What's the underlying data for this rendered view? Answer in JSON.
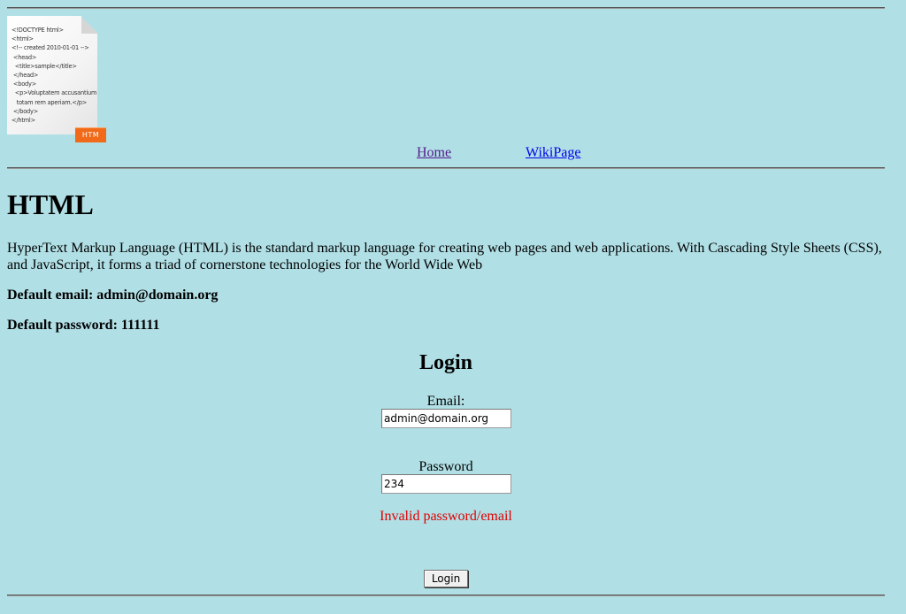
{
  "header": {
    "logo_icon": "html-document-icon",
    "logo_code_lines": [
      "<!DOCTYPE html>",
      "<html>",
      "<!-- created 2010-01-01 -->",
      " <head>",
      "  <title>sample</title>",
      " </head>",
      " <body>",
      "  <p>Voluptatem accusantium",
      "   totam rem aperiam.</p>",
      " </body>",
      "</html>"
    ],
    "logo_badge": "HTM"
  },
  "nav": {
    "home_label": "Home",
    "wiki_label": "WikiPage"
  },
  "main": {
    "title": "HTML",
    "description": "HyperText Markup Language (HTML) is the standard markup language for creating web pages and web applications. With Cascading Style Sheets (CSS), and JavaScript, it forms a triad of cornerstone technologies for the World Wide Web",
    "default_email": "Default email: admin@domain.org",
    "default_password": "Default password: 111111"
  },
  "login": {
    "title": "Login",
    "email_label": "Email:",
    "email_value": "admin@domain.org",
    "password_label": "Password",
    "password_value": "234",
    "error_text": "Invalid password/email",
    "button_label": "Login"
  },
  "colors": {
    "background": "#b0dfe5",
    "error": "#e00000",
    "link_visited": "#551a8b",
    "link": "#0000ee",
    "badge": "#f06a1a"
  }
}
